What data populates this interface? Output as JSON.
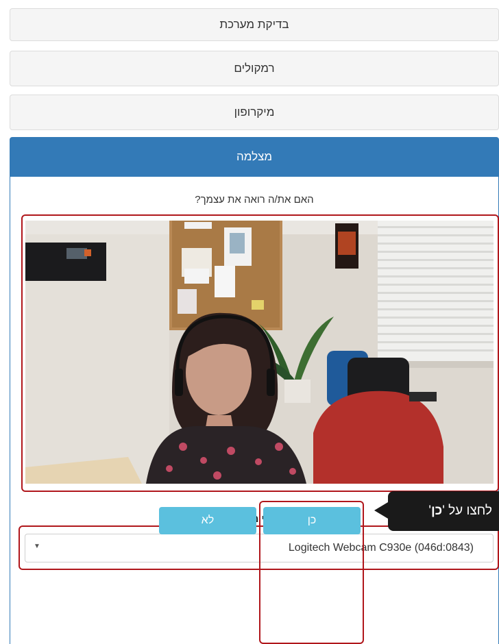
{
  "sections": {
    "system_check": "בדיקת מערכת",
    "speakers": "רמקולים",
    "microphone": "מיקרופון",
    "camera": "מצלמה"
  },
  "camera": {
    "question": "האם את/ה רואה את עצמך?",
    "select_label": "בחר/י מצלמה:",
    "selected_device": "(Logitech Webcam C930e (046d:0843"
  },
  "buttons": {
    "no": "לא",
    "yes": "כן"
  },
  "callout": {
    "prefix": "לחצו על '",
    "keyword": "כן",
    "suffix": "'"
  },
  "colors": {
    "active_header": "#337ab7",
    "button": "#5bc0de",
    "annotation": "#b0161b"
  },
  "icons": {
    "select_caret": "caret-down-icon"
  }
}
